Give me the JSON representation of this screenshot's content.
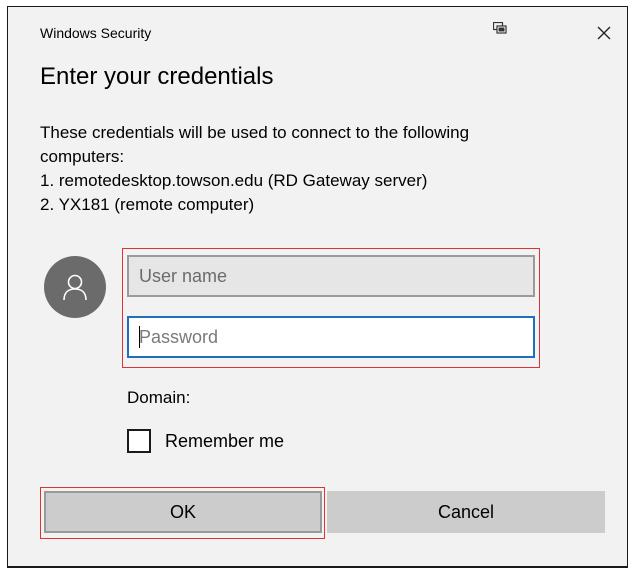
{
  "window": {
    "title": "Windows Security",
    "window_icon": "remote-desktop-icon",
    "close_icon": "close-icon"
  },
  "dialog": {
    "heading": "Enter your credentials",
    "description_lines": [
      "These credentials will be used to connect to the following",
      "computers:",
      "1. remotedesktop.towson.edu (RD Gateway server)",
      "2. YX181 (remote computer)"
    ]
  },
  "form": {
    "avatar_icon": "user-icon",
    "username": {
      "value": "",
      "placeholder": "User name"
    },
    "password": {
      "value": "",
      "placeholder": "Password"
    },
    "domain_label": "Domain:",
    "remember_me": {
      "label": "Remember me",
      "checked": false
    }
  },
  "buttons": {
    "ok_label": "OK",
    "cancel_label": "Cancel"
  },
  "colors": {
    "dialog_background": "#f2f2f2",
    "focus_border": "#1f6fbf",
    "highlight_annotation": "#e03232",
    "button_background": "#cccccc",
    "avatar_background": "#6b6b6b"
  }
}
